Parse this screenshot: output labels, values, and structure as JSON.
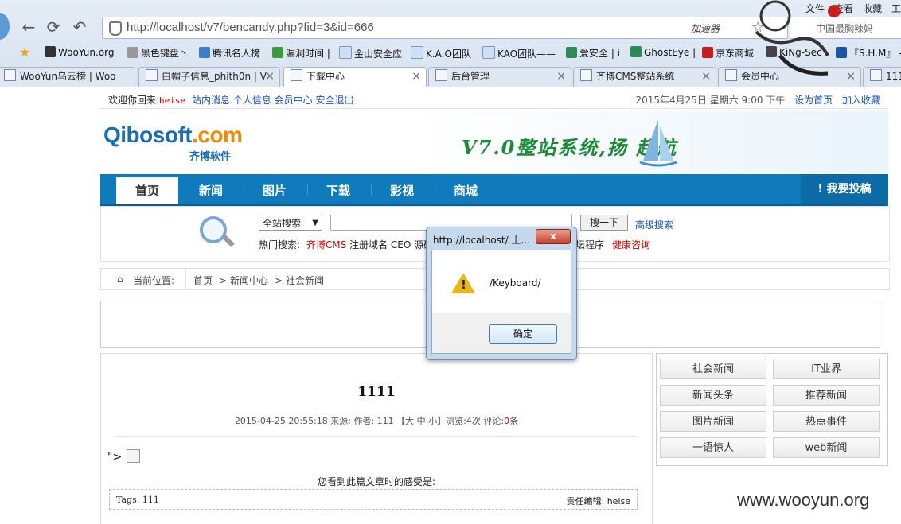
{
  "browser": {
    "url": "http://localhost/v7/bencandy.php?fid=3&id=666",
    "accelerator": "加速器",
    "search_placeholder": "中国最胸辣妈",
    "menu": [
      "文件",
      "查看",
      "收藏",
      "工"
    ],
    "bookmarks": [
      "WooYun.org",
      "黑色键盘丶",
      "腾讯名人榜",
      "漏洞时间 |",
      "金山安全应",
      "K.A.O团队",
      "KAO团队——",
      "爱安全 | i",
      "GhostEye |",
      "京东商城",
      "KiNg-Sec -",
      "『S.H.M』 -"
    ],
    "tabs": [
      {
        "label": "WooYun乌云榜 | Woo",
        "active": false
      },
      {
        "label": "白帽子信息_phith0n | V",
        "active": false
      },
      {
        "label": "下载中心",
        "active": true
      },
      {
        "label": "后台管理",
        "active": false
      },
      {
        "label": "齐博CMS整站系统",
        "active": false
      },
      {
        "label": "会员中心",
        "active": false
      },
      {
        "label": "1111",
        "active": false
      }
    ]
  },
  "topbar": {
    "welcome": "欢迎你回来:",
    "user": "heise",
    "links": "站内消息  个人信息  会员中心  安全退出",
    "date": "2015年4月25日  星期六  9:00  下午",
    "set_home": "设为首页",
    "favorite": "加入收藏"
  },
  "header": {
    "logo_main": "Qibosoft",
    "logo_com": ".com",
    "logo_sub": "齐博软件",
    "banner": "V7.0整站系统,扬 起航"
  },
  "nav": {
    "items": [
      "首页",
      "新闻",
      "图片",
      "下载",
      "影视",
      "商城"
    ],
    "contribute": "我要投稿"
  },
  "search": {
    "scope": "全站搜索",
    "button": "搜一下",
    "advanced": "高级搜索",
    "hot_label": "热门搜索:",
    "hot_first": "齐博CMS",
    "hot_middle": " 注册域名 CEO 源码",
    "hot_tail": "坛程序",
    "hot_last": "健康咨询"
  },
  "breadcrumb": {
    "label": "当前位置:",
    "path": "首页 -> 新闻中心 -> 社会新闻"
  },
  "article": {
    "title": "1111",
    "meta": "2015-04-25 20:55:18 来源: 作者: 111 【大 中 小】浏览:4次 评论:",
    "comments": "0",
    "comments_unit": "条",
    "body_prefix": "\">",
    "feel": "您看到此篇文章时的感受是:",
    "tags": "Tags: 111",
    "editor": "责任编辑: heise"
  },
  "sidebar": {
    "categories": [
      "社会新闻",
      "IT业界",
      "新闻头条",
      "推荐新闻",
      "图片新闻",
      "热点事件",
      "一语惊人",
      "web新闻"
    ]
  },
  "dialog": {
    "title": "http://localhost/ 上...",
    "message": "/Keyboard/",
    "ok": "确定",
    "close": "x"
  },
  "watermark": "www.wooyun.org",
  "colors": {
    "nav_blue": "#0f7bbd",
    "link_blue": "#1a55a8",
    "accent_red": "#cc0000",
    "warning_yellow": "#e8b617"
  }
}
